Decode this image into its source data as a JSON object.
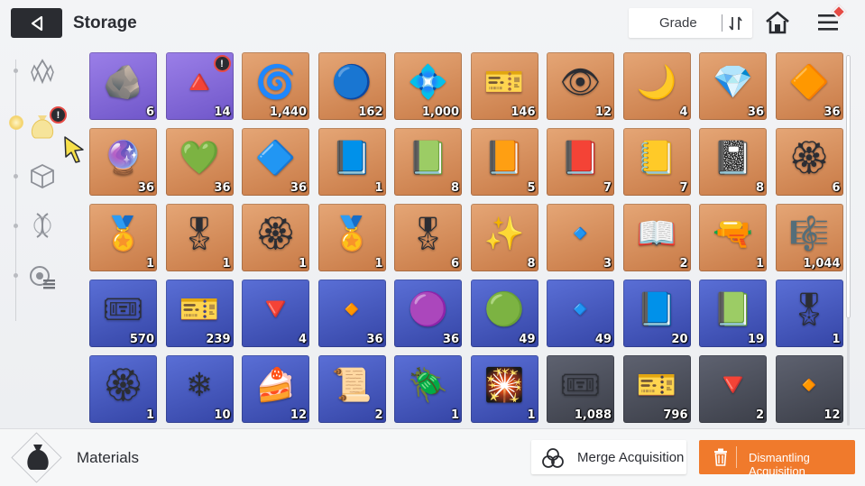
{
  "header": {
    "title": "Storage",
    "sort_label": "Grade",
    "back_icon": "back-arrow-icon",
    "home_icon": "home-icon",
    "menu_icon": "menu-icon"
  },
  "sidebar": {
    "categories": [
      {
        "name": "crystal-category-icon",
        "active": false
      },
      {
        "name": "materials-bag-category-icon",
        "active": true,
        "badge": "!"
      },
      {
        "name": "cube-category-icon",
        "active": false
      },
      {
        "name": "dna-category-icon",
        "active": false
      },
      {
        "name": "chip-category-icon",
        "active": false
      }
    ]
  },
  "items": [
    {
      "name": "red-meteor-shard",
      "glyph": "🪨",
      "grade": "purple",
      "qty": "6"
    },
    {
      "name": "golden-pyramid-relic",
      "glyph": "🔺",
      "grade": "purple",
      "qty": "14",
      "badge": "!"
    },
    {
      "name": "blue-coral-core",
      "glyph": "🌀",
      "grade": "orange",
      "qty": "1,440"
    },
    {
      "name": "cyan-energy-capsule",
      "glyph": "🔵",
      "grade": "orange",
      "qty": "162"
    },
    {
      "name": "dark-data-chip",
      "glyph": "💠",
      "grade": "orange",
      "qty": "1,000"
    },
    {
      "name": "gold-ticket",
      "glyph": "🎫",
      "grade": "orange",
      "qty": "146"
    },
    {
      "name": "purple-eye-orb",
      "glyph": "👁",
      "grade": "orange",
      "qty": "12"
    },
    {
      "name": "golden-moon-feather",
      "glyph": "🌙",
      "grade": "orange",
      "qty": "4"
    },
    {
      "name": "pink-crystal",
      "glyph": "💎",
      "grade": "orange",
      "qty": "36"
    },
    {
      "name": "orange-crystal",
      "glyph": "🔶",
      "grade": "orange",
      "qty": "36"
    },
    {
      "name": "purple-crystal",
      "glyph": "🔮",
      "grade": "orange",
      "qty": "36"
    },
    {
      "name": "green-crystal",
      "glyph": "💚",
      "grade": "orange",
      "qty": "36"
    },
    {
      "name": "blue-crystal",
      "glyph": "🔷",
      "grade": "orange",
      "qty": "36"
    },
    {
      "name": "sword-manual",
      "glyph": "📘",
      "grade": "orange",
      "qty": "1"
    },
    {
      "name": "shield-manual",
      "glyph": "📗",
      "grade": "orange",
      "qty": "8"
    },
    {
      "name": "eye-manual",
      "glyph": "📙",
      "grade": "orange",
      "qty": "5"
    },
    {
      "name": "blade-manual",
      "glyph": "📕",
      "grade": "orange",
      "qty": "7"
    },
    {
      "name": "bolt-manual",
      "glyph": "📒",
      "grade": "orange",
      "qty": "7"
    },
    {
      "name": "target-manual",
      "glyph": "📓",
      "grade": "orange",
      "qty": "8"
    },
    {
      "name": "cross-medal",
      "glyph": "🏵",
      "grade": "orange",
      "qty": "6"
    },
    {
      "name": "shield-medal",
      "glyph": "🏅",
      "grade": "orange",
      "qty": "1"
    },
    {
      "name": "eye-medal",
      "glyph": "🎖",
      "grade": "orange",
      "qty": "1"
    },
    {
      "name": "blade-medal",
      "glyph": "🏵",
      "grade": "orange",
      "qty": "1"
    },
    {
      "name": "bolt-medal",
      "glyph": "🏅",
      "grade": "orange",
      "qty": "1"
    },
    {
      "name": "target-medal",
      "glyph": "🎖",
      "grade": "orange",
      "qty": "6"
    },
    {
      "name": "green-spark-shard",
      "glyph": "✨",
      "grade": "orange",
      "qty": "8"
    },
    {
      "name": "blue-cube-crystal",
      "glyph": "🔹",
      "grade": "orange",
      "qty": "3"
    },
    {
      "name": "star-map-book",
      "glyph": "📖",
      "grade": "orange",
      "qty": "2"
    },
    {
      "name": "spray-gun",
      "glyph": "🔫",
      "grade": "orange",
      "qty": "1"
    },
    {
      "name": "music-record",
      "glyph": "🎼",
      "grade": "orange",
      "qty": "1,044"
    },
    {
      "name": "blue-ticket",
      "glyph": "🎟",
      "grade": "blue",
      "qty": "570"
    },
    {
      "name": "star-ticket",
      "glyph": "🎫",
      "grade": "blue",
      "qty": "239"
    },
    {
      "name": "red-shard",
      "glyph": "🔻",
      "grade": "blue",
      "qty": "4"
    },
    {
      "name": "amber-shard",
      "glyph": "🔸",
      "grade": "blue",
      "qty": "36"
    },
    {
      "name": "violet-shard",
      "glyph": "🟣",
      "grade": "blue",
      "qty": "36"
    },
    {
      "name": "emerald-shard",
      "glyph": "🟢",
      "grade": "blue",
      "qty": "49"
    },
    {
      "name": "ice-shard",
      "glyph": "🔹",
      "grade": "blue",
      "qty": "49"
    },
    {
      "name": "shield-book",
      "glyph": "📘",
      "grade": "blue",
      "qty": "20"
    },
    {
      "name": "wing-book",
      "glyph": "📗",
      "grade": "blue",
      "qty": "19"
    },
    {
      "name": "silver-medal",
      "glyph": "🎖",
      "grade": "blue",
      "qty": "1"
    },
    {
      "name": "eye-emblem",
      "glyph": "🏵",
      "grade": "blue",
      "qty": "1"
    },
    {
      "name": "shatter-crystal",
      "glyph": "❄",
      "grade": "blue",
      "qty": "10"
    },
    {
      "name": "strawberry-cake",
      "glyph": "🍰",
      "grade": "blue",
      "qty": "12"
    },
    {
      "name": "gold-scroll",
      "glyph": "📜",
      "grade": "blue",
      "qty": "2"
    },
    {
      "name": "black-beetle",
      "glyph": "🪲",
      "grade": "blue",
      "qty": "1"
    },
    {
      "name": "sparkler",
      "glyph": "🎇",
      "grade": "blue",
      "qty": "1"
    },
    {
      "name": "gray-ticket",
      "glyph": "🎟",
      "grade": "gray",
      "qty": "1,088"
    },
    {
      "name": "compass-ticket",
      "glyph": "🎫",
      "grade": "gray",
      "qty": "796"
    },
    {
      "name": "dull-red-shard",
      "glyph": "🔻",
      "grade": "gray",
      "qty": "2"
    },
    {
      "name": "dull-amber-shard",
      "glyph": "🔸",
      "grade": "gray",
      "qty": "12"
    }
  ],
  "footer": {
    "category_label": "Materials",
    "merge_label": "Merge Acquisition",
    "dismantle_label": "Dismantling Acquisition"
  },
  "colors": {
    "accent_orange": "#f07a2c",
    "badge_red": "#e64a44",
    "dark": "#2a2c31"
  }
}
